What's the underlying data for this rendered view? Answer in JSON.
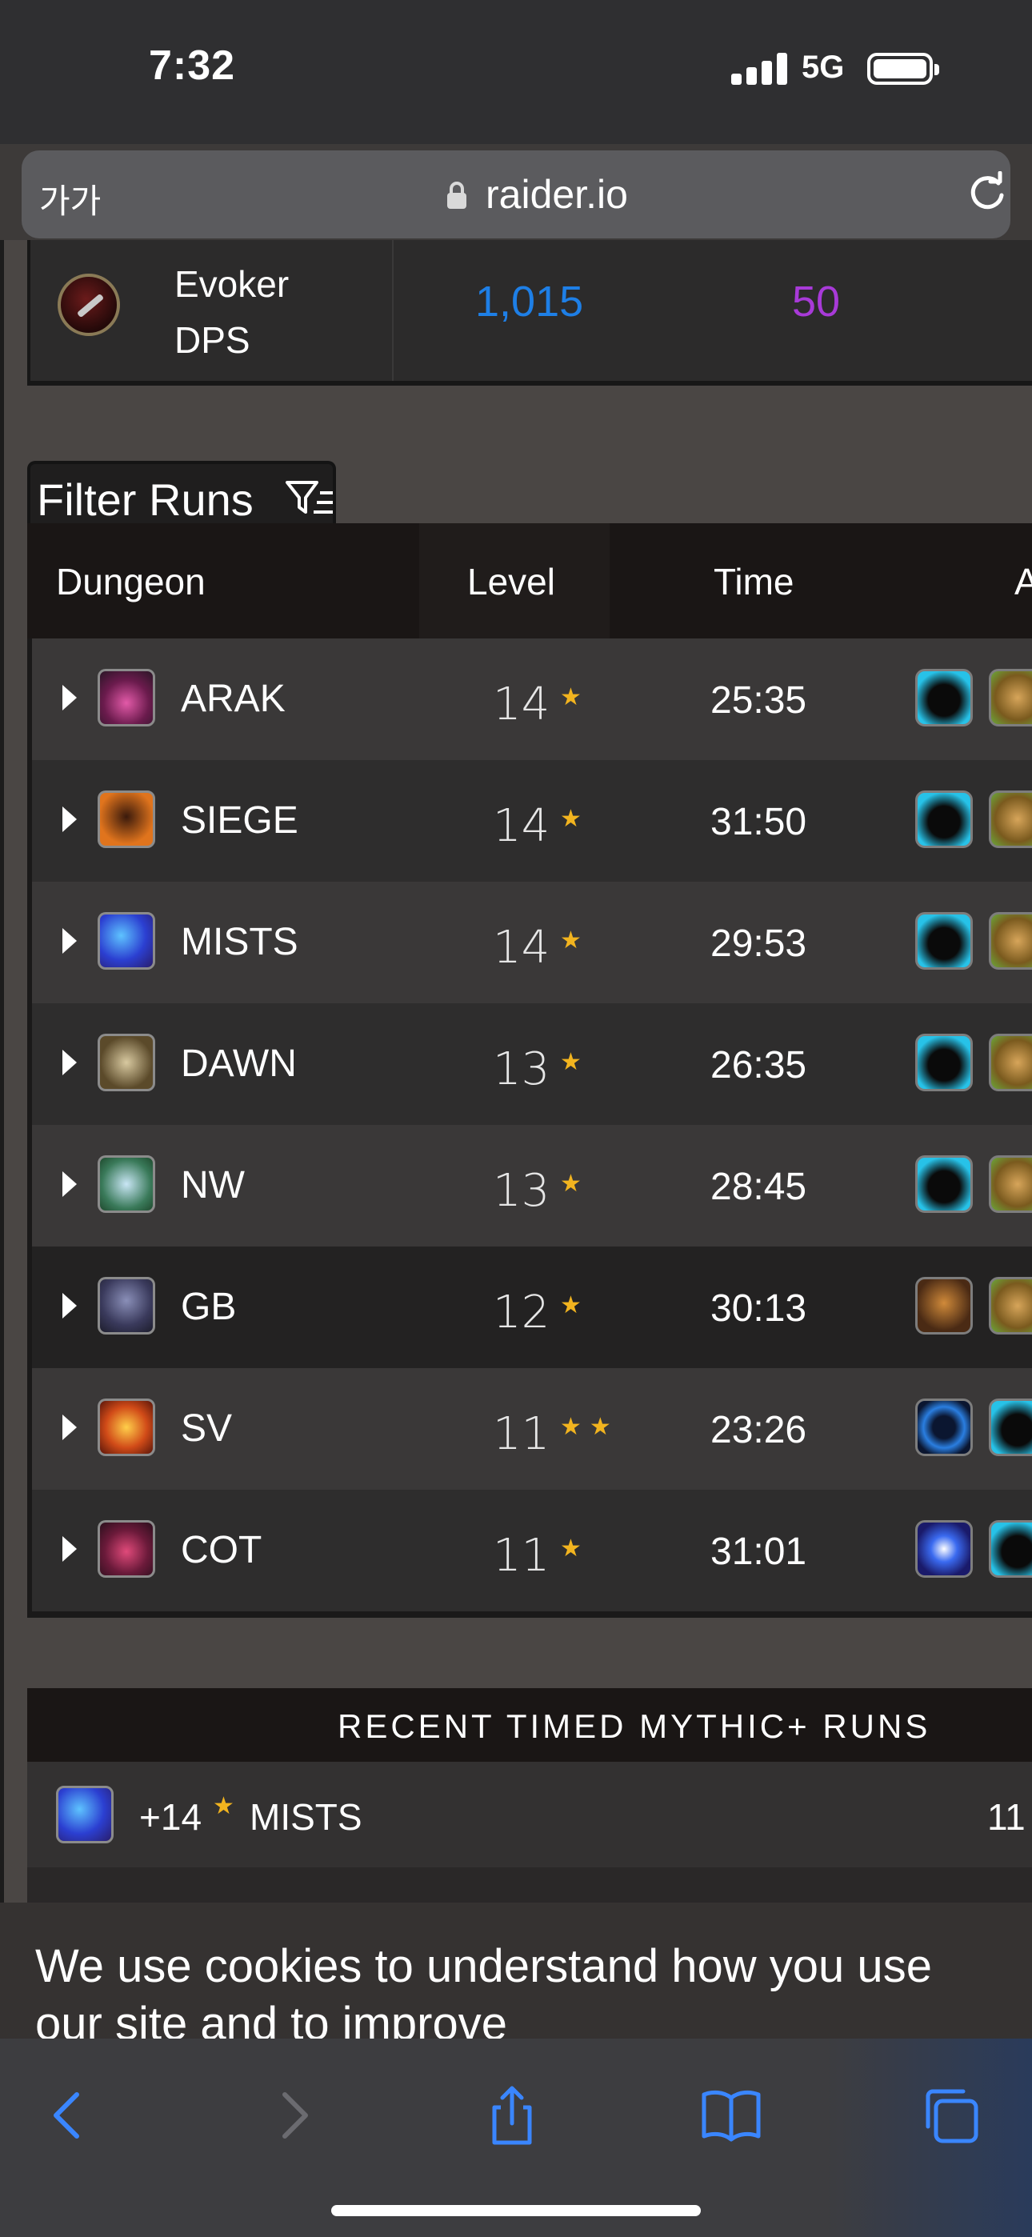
{
  "status_bar": {
    "time": "7:32",
    "network": "5G"
  },
  "browser": {
    "text_size_label": "가가",
    "domain": "raider.io"
  },
  "class_summary": {
    "class_name": "Evoker",
    "role": "DPS",
    "score": "1,015",
    "rank": "50",
    "score_color": "#1e7fe6",
    "rank_color": "#a83ad8"
  },
  "filter": {
    "label": "Filter Runs"
  },
  "table": {
    "headers": {
      "dungeon": "Dungeon",
      "level": "Level",
      "time": "Time",
      "affixes_partial": "A"
    },
    "rows": [
      {
        "dungeon": "ARAK",
        "level": "14",
        "stars": "★",
        "time": "25:35"
      },
      {
        "dungeon": "SIEGE",
        "level": "14",
        "stars": "★",
        "time": "31:50"
      },
      {
        "dungeon": "MISTS",
        "level": "14",
        "stars": "★",
        "time": "29:53"
      },
      {
        "dungeon": "DAWN",
        "level": "13",
        "stars": "★",
        "time": "26:35"
      },
      {
        "dungeon": "NW",
        "level": "13",
        "stars": "★",
        "time": "28:45"
      },
      {
        "dungeon": "GB",
        "level": "12",
        "stars": "★",
        "time": "30:13"
      },
      {
        "dungeon": "SV",
        "level": "11",
        "stars": "★★",
        "time": "23:26"
      },
      {
        "dungeon": "COT",
        "level": "11",
        "stars": "★",
        "time": "31:01"
      }
    ]
  },
  "recent_runs": {
    "title": "RECENT TIMED MYTHIC+ RUNS",
    "first": {
      "level": "+14",
      "stars": "★",
      "dungeon": "MISTS",
      "score_partial": "11"
    }
  },
  "cookie_banner": {
    "text": "We use cookies to understand how you use our site and to improve"
  },
  "toolbar": {
    "icons": [
      "back-icon",
      "forward-icon",
      "share-icon",
      "bookmarks-icon",
      "tabs-icon"
    ]
  },
  "accent": {
    "star": "#f2b41f",
    "ios_blue": "#3a86ff"
  }
}
